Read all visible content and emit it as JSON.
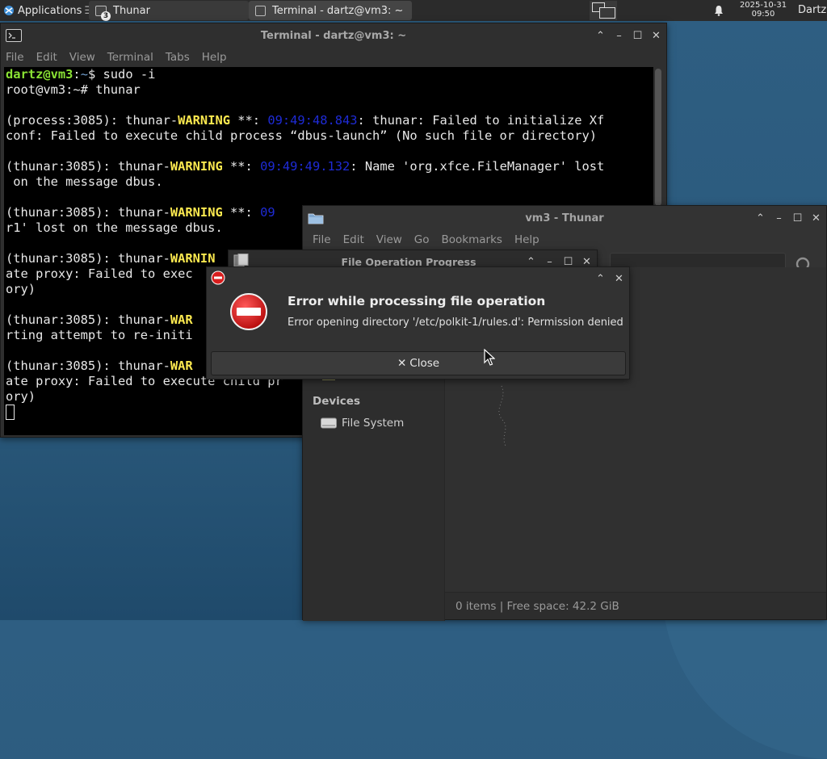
{
  "panel": {
    "applications_label": "Applications",
    "tasks": [
      {
        "label": "Thunar",
        "badge": "3"
      },
      {
        "label": "Terminal - dartz@vm3: ~"
      }
    ],
    "clock_date": "2025-10-31",
    "clock_time": "09:50",
    "user": "Dartz"
  },
  "terminal": {
    "title": "Terminal - dartz@vm3: ~",
    "menu": [
      "File",
      "Edit",
      "View",
      "Terminal",
      "Tabs",
      "Help"
    ],
    "prompt_user": "dartz@vm3",
    "prompt_path": "~",
    "command1": " sudo -i",
    "line2": "root@vm3:~# thunar",
    "w1_pre": "(process:3085): thunar-",
    "w1_ts": "09:49:48.843",
    "w1_post": ": thunar: Failed to initialize Xf",
    "w1_cont": "conf: Failed to execute child process “dbus-launch” (No such file or directory)",
    "w2_pre": "(thunar:3085): thunar-",
    "w2_ts": "09:49:49.132",
    "w2_post": ": Name 'org.xfce.FileManager' lost",
    "w2_cont": " on the message dbus.",
    "w3_pre": "(thunar:3085): thunar-",
    "w3_ts": "09",
    "w3_cont": "r1' lost on the message dbus.",
    "w4_pre": "(thunar:3085): thunar-",
    "w4_label": "WARNIN",
    "w4_cont": "ate proxy: Failed to exec",
    "w4_cont2": "ory)",
    "w5_pre": "(thunar:3085): thunar-",
    "w5_label": "WAR",
    "w5_cont": "rting attempt to re-initi",
    "w6_pre": "(thunar:3085): thunar-",
    "w6_label": "WAR",
    "w6_cont": "ate proxy: Failed to execute child pr",
    "w6_cont2": "ory)",
    "warning_label": "WARNING",
    "stars": " **: "
  },
  "thunar": {
    "title": "vm3 - Thunar",
    "menu": [
      "File",
      "Edit",
      "View",
      "Go",
      "Bookmarks",
      "Help"
    ],
    "devices_header": "Devices",
    "devices": [
      {
        "label": "File System"
      }
    ],
    "status": "0 items  |  Free space: 42.2 GiB"
  },
  "progress": {
    "title": "File Operation Progress"
  },
  "error_dialog": {
    "title": "Error while processing file operation",
    "message": "Error opening directory '/etc/polkit-1/rules.d': Permission denied",
    "close_label": "Close"
  }
}
